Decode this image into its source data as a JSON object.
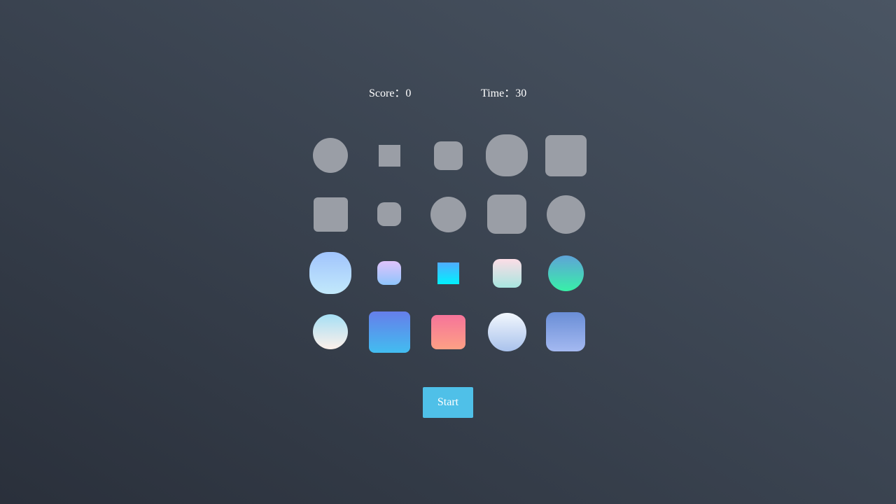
{
  "hud": {
    "score_text": "Score：0",
    "time_text": "Time：30"
  },
  "board": {
    "rows": [
      [
        {
          "shape": "circle",
          "style": "gray"
        },
        {
          "shape": "square",
          "style": "gray"
        },
        {
          "shape": "rounded-square",
          "style": "gray"
        },
        {
          "shape": "squircle",
          "style": "gray"
        },
        {
          "shape": "rounded-square",
          "style": "gray"
        }
      ],
      [
        {
          "shape": "rounded-square",
          "style": "gray"
        },
        {
          "shape": "rounded-square",
          "style": "gray"
        },
        {
          "shape": "circle",
          "style": "gray"
        },
        {
          "shape": "rounded-square",
          "style": "gray"
        },
        {
          "shape": "circle",
          "style": "gray"
        }
      ],
      [
        {
          "shape": "squircle",
          "style": "gradient",
          "colors": [
            "#a1c4fd",
            "#c2e9fb"
          ]
        },
        {
          "shape": "rounded-square",
          "style": "gradient",
          "colors": [
            "#e0c3fc",
            "#8ec5fc"
          ]
        },
        {
          "shape": "square",
          "style": "gradient",
          "colors": [
            "#4facfe",
            "#00f2fe"
          ]
        },
        {
          "shape": "rounded-square",
          "style": "gradient",
          "colors": [
            "#fcdde6",
            "#a8e6e0"
          ]
        },
        {
          "shape": "circle",
          "style": "gradient",
          "colors": [
            "#5fa3d8",
            "#38f0a8"
          ]
        }
      ],
      [
        {
          "shape": "circle",
          "style": "gradient",
          "colors": [
            "#a6dff5",
            "#fdf0ea"
          ]
        },
        {
          "shape": "rounded-square",
          "style": "gradient",
          "colors": [
            "#667eea",
            "#42bdf0"
          ]
        },
        {
          "shape": "rounded-square",
          "style": "gradient",
          "colors": [
            "#f6749a",
            "#fda085"
          ]
        },
        {
          "shape": "circle",
          "style": "gradient",
          "colors": [
            "#f2f7fd",
            "#a9c2ec"
          ]
        },
        {
          "shape": "rounded-square",
          "style": "gradient",
          "colors": [
            "#6a8ed6",
            "#a4b9f1"
          ]
        }
      ]
    ]
  },
  "start_button": {
    "label": "Start",
    "color": "#4fc0e8"
  }
}
